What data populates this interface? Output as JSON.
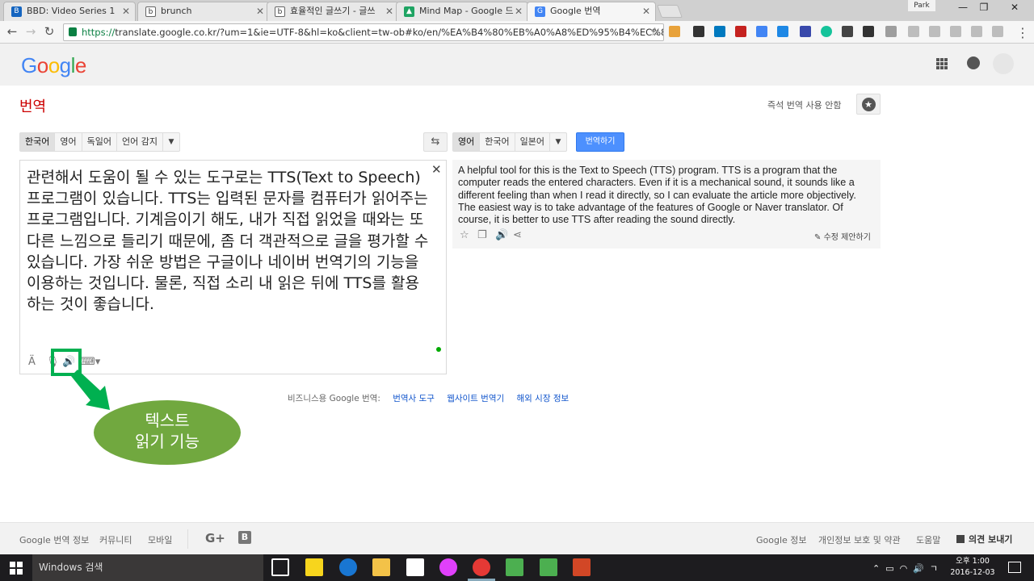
{
  "browser": {
    "tabs": [
      {
        "title": "BBD: Video Series 1",
        "icon_color": "#1565c0",
        "active": false
      },
      {
        "title": "brunch",
        "icon_color": "#333333",
        "active": false
      },
      {
        "title": "효율적인 글쓰기 - 글쓰",
        "icon_color": "#333333",
        "active": false
      },
      {
        "title": "Mind Map - Google 드",
        "icon_color": "#1fa463",
        "active": false
      },
      {
        "title": "Google 번역",
        "icon_color": "#4285f4",
        "active": true
      }
    ],
    "profile": "Park",
    "url_scheme": "https://",
    "url_rest": "translate.google.co.kr/?um=1&ie=UTF-8&hl=ko&client=tw-ob#ko/en/%EA%B4%80%EB%A0%A8%ED%95%B4%EC%84%9C%"
  },
  "header": {
    "logo": "Google",
    "page_title": "번역",
    "instant_off": "즉석 번역 사용 안함"
  },
  "source": {
    "langs": [
      "한국어",
      "영어",
      "독일어",
      "언어 감지"
    ],
    "text": "관련해서 도움이 될 수 있는 도구로는 TTS(Text to Speech) 프로그램이 있습니다. TTS는 입력된 문자를 컴퓨터가 읽어주는 프로그램입니다. 기계음이기 해도, 내가 직접 읽었을 때와는 또 다른 느낌으로 들리기 때문에, 좀 더 객관적으로 글을 평가할 수 있습니다. 가장 쉬운 방법은 구글이나 네이버 번역기의 기능을 이용하는 것입니다. 물론, 직접 소리 내 읽은 뒤에 TTS를 활용하는 것이 좋습니다."
  },
  "target": {
    "langs": [
      "영어",
      "한국어",
      "일본어"
    ],
    "translate_button": "번역하기",
    "text": "A helpful tool for this is the Text to Speech (TTS) program. TTS is a program that the computer reads the entered characters. Even if it is a mechanical sound, it sounds like a different feeling than when I read it directly, so I can evaluate the article more objectively. The easiest way is to take advantage of the features of Google or Naver translator. Of course, it is better to use TTS after reading the sound directly.",
    "suggest_edit": "수정 제안하기"
  },
  "business": {
    "label": "비즈니스용 Google 번역:",
    "links": [
      "번역사 도구",
      "웹사이트 번역기",
      "해외 시장 정보"
    ]
  },
  "annotation": {
    "callout_line1": "텍스트",
    "callout_line2": "읽기 기능",
    "color": "#00b050"
  },
  "footer": {
    "left": [
      "Google 번역 정보",
      "커뮤니티",
      "모바일"
    ],
    "right": [
      "Google 정보",
      "개인정보 보호 및 약관",
      "도움말"
    ],
    "feedback": "의견 보내기"
  },
  "taskbar": {
    "search_placeholder": "Windows 검색",
    "time": "오후 1:00",
    "date": "2016-12-03"
  }
}
